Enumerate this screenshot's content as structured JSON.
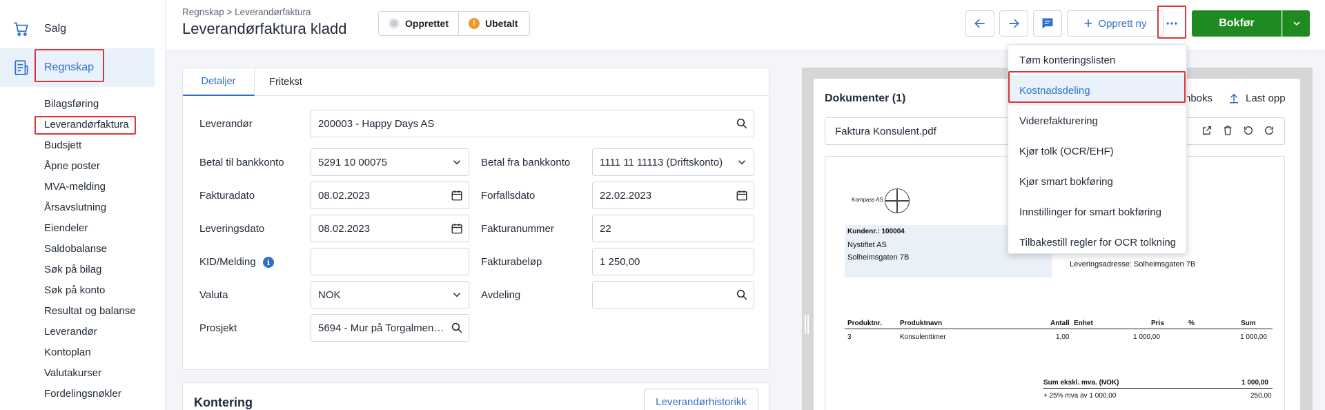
{
  "sidebar": {
    "top_items": [
      {
        "label": "Salg",
        "icon": "cart-icon"
      },
      {
        "label": "Regnskap",
        "icon": "ledger-icon",
        "active": true
      }
    ],
    "sub_items": [
      "Bilagsføring",
      "Leverandørfaktura",
      "Budsjett",
      "Åpne poster",
      "MVA-melding",
      "Årsavslutning",
      "Eiendeler",
      "Saldobalanse",
      "Søk på bilag",
      "Søk på konto",
      "Resultat og balanse",
      "Leverandør",
      "Kontoplan",
      "Valutakurser",
      "Fordelingsnøkler"
    ]
  },
  "header": {
    "breadcrumb": "Regnskap > Leverandørfaktura",
    "title": "Leverandørfaktura kladd",
    "statuses": [
      {
        "label": "Opprettet",
        "icon": "circle-status-icon"
      },
      {
        "label": "Ubetalt",
        "icon": "warning-icon"
      }
    ],
    "new_label": "Opprett ny",
    "bokfor_label": "Bokfør",
    "accent_color": "#2f6fc9",
    "primary_color": "#1f8a1f"
  },
  "form": {
    "tabs": [
      "Detaljer",
      "Fritekst"
    ],
    "leverandor": {
      "label": "Leverandør",
      "value": "200003 - Happy Days AS"
    },
    "betal_til": {
      "label": "Betal til bankkonto",
      "value": "5291 10 00075"
    },
    "betal_fra": {
      "label": "Betal fra bankkonto",
      "value": "1111 11 11113 (Driftskonto)"
    },
    "fakturadato": {
      "label": "Fakturadato",
      "value": "08.02.2023"
    },
    "forfallsdato": {
      "label": "Forfallsdato",
      "value": "22.02.2023"
    },
    "leveringsdato": {
      "label": "Leveringsdato",
      "value": "08.02.2023"
    },
    "fakturanummer": {
      "label": "Fakturanummer",
      "value": "22"
    },
    "kid": {
      "label": "KID/Melding",
      "value": ""
    },
    "fakturabelop": {
      "label": "Fakturabeløp",
      "value": "1 250,00"
    },
    "valuta": {
      "label": "Valuta",
      "value": "NOK"
    },
    "avdeling": {
      "label": "Avdeling",
      "value": ""
    },
    "prosjekt": {
      "label": "Prosjekt",
      "value": "5694 - Mur på Torgalmenningen"
    }
  },
  "kontering": {
    "title": "Kontering",
    "history_button": "Leverandørhistorikk"
  },
  "documents": {
    "title": "Dokumenter (1)",
    "inbox_label": "nboks",
    "upload_label": "Last opp",
    "file_name": "Faktura Konsulent.pdf",
    "pdf": {
      "company": "Kompass AS",
      "customer_no": "Kundenr.: 100004",
      "customer_name": "Nystiftet AS",
      "customer_address": "Solheimsgaten 7B",
      "delivery_address": "Leveringsadresse:  Solheimsgaten 7B",
      "columns": [
        "Produktnr.",
        "Produktnavn",
        "Antall",
        "Enhet",
        "Pris",
        "%",
        "Sum"
      ],
      "row": {
        "nr": "3",
        "name": "Konsulenttimer",
        "antall": "1,00",
        "enhet": "",
        "pris": "1 000,00",
        "pct": "",
        "sum": "1 000,00"
      },
      "sum_label": "Sum ekskl. mva. (NOK)",
      "sum_value": "1 000,00",
      "mva_label": "+ 25% mva av 1 000,00",
      "mva_value": "250,00"
    }
  },
  "dropdown": {
    "items": [
      "Tøm konteringslisten",
      "Kostnadsdeling",
      "Viderefakturering",
      "Kjør tolk (OCR/EHF)",
      "Kjør smart bokføring",
      "Innstillinger for smart bokføring",
      "Tilbakestill regler for OCR tolkning"
    ],
    "active_index": 1
  },
  "highlight_color": "#d93636"
}
